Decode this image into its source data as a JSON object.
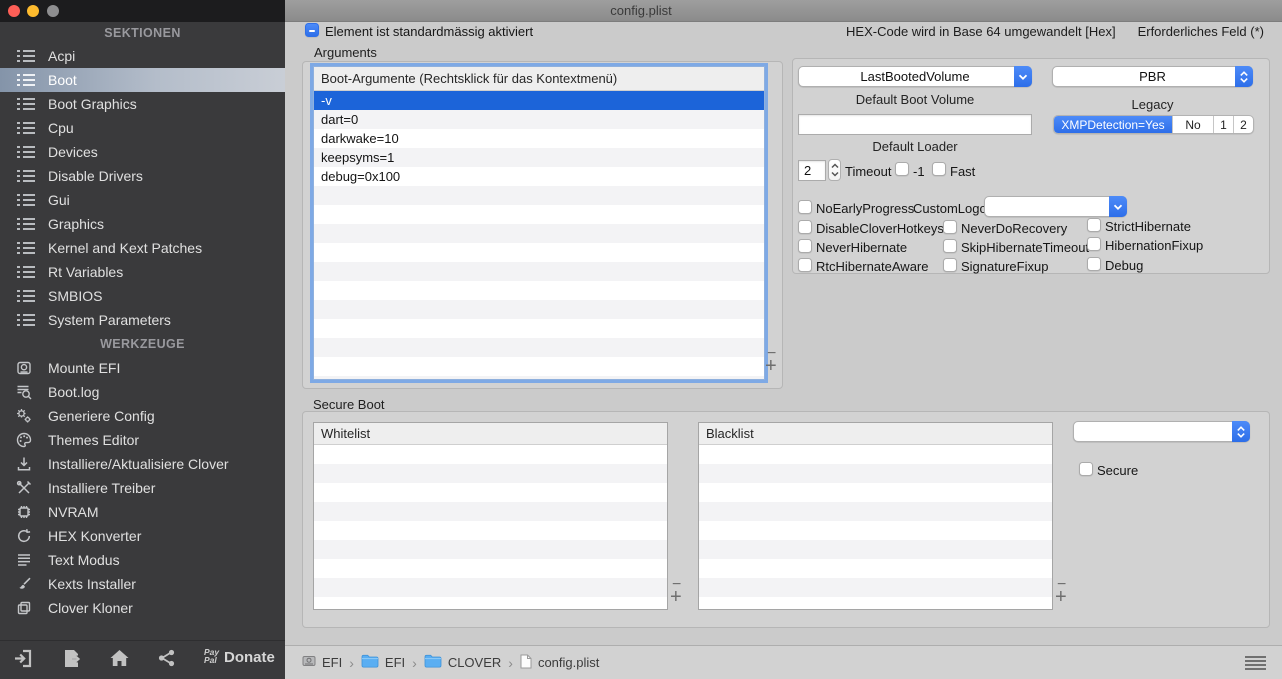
{
  "titlebar": {
    "title": "config.plist"
  },
  "header": {
    "default_checkbox_label": "Element ist standardmässig aktiviert",
    "hex_hint": "HEX-Code wird in Base 64 umgewandelt [Hex]",
    "required_hint": "Erforderliches Feld (*)"
  },
  "sidebar": {
    "sections_header": "SEKTIONEN",
    "sections": [
      {
        "label": "Acpi"
      },
      {
        "label": "Boot",
        "selected": true
      },
      {
        "label": "Boot Graphics"
      },
      {
        "label": "Cpu"
      },
      {
        "label": "Devices"
      },
      {
        "label": "Disable Drivers"
      },
      {
        "label": "Gui"
      },
      {
        "label": "Graphics"
      },
      {
        "label": "Kernel and Kext Patches"
      },
      {
        "label": "Rt Variables"
      },
      {
        "label": "SMBIOS"
      },
      {
        "label": "System Parameters"
      }
    ],
    "tools_header": "WERKZEUGE",
    "tools": [
      {
        "label": "Mounte EFI",
        "icon": "drive-icon"
      },
      {
        "label": "Boot.log",
        "icon": "log-search-icon"
      },
      {
        "label": "Generiere Config",
        "icon": "gears-icon"
      },
      {
        "label": "Themes Editor",
        "icon": "palette-icon"
      },
      {
        "label": "Installiere/Aktualisiere Clover",
        "icon": "download-icon"
      },
      {
        "label": "Installiere Treiber",
        "icon": "tools-icon"
      },
      {
        "label": "NVRAM",
        "icon": "chip-icon"
      },
      {
        "label": "HEX Konverter",
        "icon": "convert-icon"
      },
      {
        "label": "Text Modus",
        "icon": "text-lines-icon"
      },
      {
        "label": "Kexts Installer",
        "icon": "brush-icon"
      },
      {
        "label": "Clover Kloner",
        "icon": "clone-icon"
      }
    ],
    "footer": {
      "paypal_line1": "Pay",
      "paypal_line2": "Pal",
      "donate_label": "Donate"
    }
  },
  "arguments": {
    "section_label": "Arguments",
    "list_header": "Boot-Argumente (Rechtsklick für das Kontextmenü)",
    "items": [
      "-v",
      "dart=0",
      "darkwake=10",
      "keepsyms=1",
      "debug=0x100"
    ],
    "selected_item": "-v",
    "remove_label": "−",
    "add_label": "+"
  },
  "boot": {
    "default_boot_volume": {
      "value": "LastBootedVolume",
      "label": "Default Boot Volume"
    },
    "legacy": {
      "value": "PBR",
      "label": "Legacy"
    },
    "default_loader": {
      "value": "",
      "label": "Default Loader"
    },
    "xmp": {
      "segments": [
        "XMPDetection=Yes",
        "No",
        "1",
        "2"
      ],
      "selected": "XMPDetection=Yes"
    },
    "timeout": {
      "value": "2",
      "label": "Timeout"
    },
    "cb_minus_one": "-1",
    "cb_fast": "Fast",
    "cb_no_early_progress": "NoEarlyProgress",
    "custom_logo_label": "CustomLogo",
    "custom_logo_value": "",
    "cb_disable_clover_hotkeys": "DisableCloverHotkeys",
    "cb_never_do_recovery": "NeverDoRecovery",
    "cb_strict_hibernate": "StrictHibernate",
    "cb_never_hibernate": "NeverHibernate",
    "cb_skip_hibernate_timeout": "SkipHibernateTimeout",
    "cb_hibernation_fixup": "HibernationFixup",
    "cb_rtc_hibernate_aware": "RtcHibernateAware",
    "cb_signature_fixup": "SignatureFixup",
    "cb_debug": "Debug"
  },
  "secure_boot": {
    "section_label": "Secure Boot",
    "whitelist_header": "Whitelist",
    "blacklist_header": "Blacklist",
    "policy_value": "",
    "cb_secure": "Secure",
    "remove_label": "−",
    "add_label": "+"
  },
  "statusbar": {
    "separator": "›",
    "breadcrumb": [
      {
        "icon": "drive-icon",
        "label": "EFI"
      },
      {
        "icon": "folder-icon",
        "label": "EFI"
      },
      {
        "icon": "folder-icon",
        "label": "CLOVER"
      },
      {
        "icon": "file-icon",
        "label": "config.plist"
      }
    ]
  }
}
